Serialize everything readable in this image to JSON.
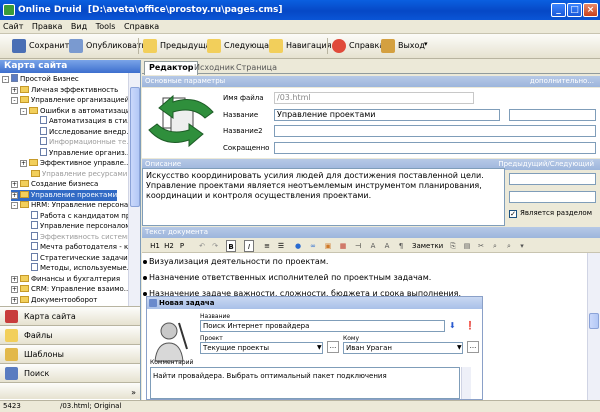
{
  "window": {
    "title": "Online Druid",
    "path": "[D:\\aveta\\office\\prostoy.ru\\pages.cms]"
  },
  "menu": [
    "Сайт",
    "Правка",
    "Вид",
    "Tools",
    "Справка"
  ],
  "toolbar": {
    "save": "Сохранить",
    "publish": "Опубликовать",
    "prev": "Предыдущая",
    "next": "Следующая",
    "nav": "Навигация",
    "help": "Справка",
    "exit": "Выход"
  },
  "sitemap": {
    "title": "Карта сайта",
    "tree": [
      {
        "label": "Простой Бизнес",
        "level": 0,
        "kind": "root",
        "exp": "-"
      },
      {
        "label": "Личная эффективность",
        "level": 1,
        "kind": "folder",
        "exp": "+"
      },
      {
        "label": "Управление организацией",
        "level": 1,
        "kind": "folder",
        "exp": "-"
      },
      {
        "label": "Ошибки в автоматизации",
        "level": 2,
        "kind": "folder",
        "exp": "-"
      },
      {
        "label": "Автоматизация в сти...",
        "level": 3,
        "kind": "doc"
      },
      {
        "label": "Исследование внедр...",
        "level": 3,
        "kind": "doc"
      },
      {
        "label": "Информационные те...",
        "level": 3,
        "kind": "doc",
        "grey": true
      },
      {
        "label": "Управление организ...",
        "level": 3,
        "kind": "doc"
      },
      {
        "label": "Эффективное управле...",
        "level": 2,
        "kind": "folder",
        "exp": "+"
      },
      {
        "label": "Управление ресурсами",
        "level": 2,
        "kind": "folder",
        "grey": true
      },
      {
        "label": "Создание бизнеса",
        "level": 1,
        "kind": "folder",
        "exp": "+"
      },
      {
        "label": "Управление проектами",
        "level": 1,
        "kind": "folder",
        "exp": "+",
        "selected": true
      },
      {
        "label": "HRM: Управление персона...",
        "level": 1,
        "kind": "folder",
        "exp": "-"
      },
      {
        "label": "Работа с кандидатом пр...",
        "level": 2,
        "kind": "doc"
      },
      {
        "label": "Управление персоналом...",
        "level": 2,
        "kind": "doc"
      },
      {
        "label": "Эффективность системы...",
        "level": 2,
        "kind": "doc",
        "grey": true
      },
      {
        "label": "Мечта работодателя - к...",
        "level": 2,
        "kind": "doc"
      },
      {
        "label": "Стратегические задачи...",
        "level": 2,
        "kind": "doc"
      },
      {
        "label": "Методы, используемые...",
        "level": 2,
        "kind": "doc"
      },
      {
        "label": "Финансы и бухгалтерия",
        "level": 1,
        "kind": "folder",
        "exp": "+"
      },
      {
        "label": "CRM: Управление взаимо...",
        "level": 1,
        "kind": "folder",
        "exp": "+"
      },
      {
        "label": "Документооборот",
        "level": 1,
        "kind": "folder",
        "exp": "+"
      }
    ],
    "nav": [
      "Карта сайта",
      "Файлы",
      "Шаблоны",
      "Поиск"
    ]
  },
  "tabs": [
    "Редактор",
    "Исходник",
    "Страница"
  ],
  "props": {
    "section": "Основные параметры",
    "more": "дополнительно...",
    "filename_label": "Имя файла",
    "filename_value": "/03.html",
    "name_label": "Название",
    "name_value": "Управление проектами",
    "name2_label": "Название2",
    "name2_value": "",
    "short_label": "Сокращенно",
    "short_value": ""
  },
  "description": {
    "section": "Описание",
    "prevnext": "Предыдущий/Следующий",
    "text": "Искусство координировать усилия людей для достижения поставленной цели. Управление проектами является неотъемлемым инструментом планирования, координации и контроля осуществления проектами.",
    "is_section_label": "Является разделом",
    "is_section": true
  },
  "doc": {
    "section": "Текст документа",
    "toolbar": {
      "h1": "H1",
      "h2": "H2",
      "p": "P",
      "bold": "B",
      "italic": "I",
      "notes": "Заметки"
    },
    "bullets": [
      "Визуализация деятельности по проектам.",
      "Назначение ответственных исполнителей по проектным задачам.",
      "Назначение задаче важности, сложности, бюджета и срока выполнения."
    ],
    "dialog": {
      "title": "Новая задача",
      "name_label": "Название",
      "name_value": "Поиск Интернет провайдера",
      "project_label": "Проект",
      "project_value": "Текущие проекты",
      "to_label": "Кому",
      "to_value": "Иван Ураган",
      "comment_label": "Комментарий",
      "comment_value": "Найти провайдера. Выбрать оптимальный пакет подключения",
      "more": "..."
    }
  },
  "status": {
    "code": "5423",
    "info": "/03.html; Original"
  },
  "colors": {
    "titlebar": "#0a55d6",
    "selection": "#316ac5",
    "section": "#9db5dc"
  }
}
